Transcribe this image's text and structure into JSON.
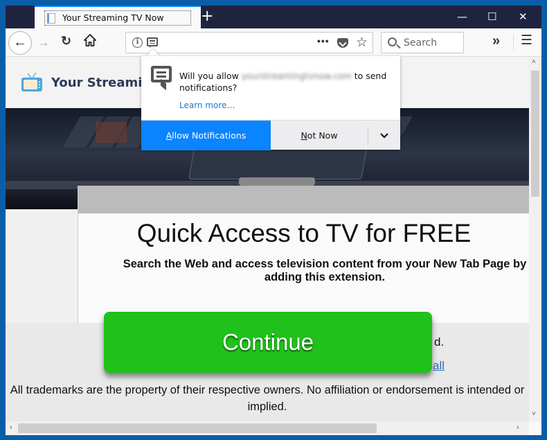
{
  "browser": {
    "tab": {
      "title": "Your Streaming TV Now",
      "close_glyph": "✕"
    },
    "new_tab_glyph": "+",
    "window_controls": {
      "minimize": "—",
      "maximize": "☐",
      "close": "✕"
    },
    "nav": {
      "back": "←",
      "forward": "→",
      "reload": "↻"
    },
    "urlbar": {
      "page_actions_glyph": "•••",
      "star_glyph": "☆"
    },
    "search": {
      "placeholder": "Search"
    },
    "overflow_glyph": "»",
    "menu_glyph": "☰"
  },
  "popup": {
    "message_before": "Will you allow ",
    "domain": "yourstreamingtvnow.com",
    "message_after": " to send notifications?",
    "learn_more": "Learn more…",
    "allow_first": "A",
    "allow_rest": "llow Notifications",
    "notnow_first": "N",
    "notnow_rest": "ot Now",
    "more_glyph": "⌄"
  },
  "page": {
    "brand": "Your Streaming",
    "headline": "Quick Access to TV for FREE",
    "subheadline": "Search the Web and access television content from your New Tab Page by adding this extension.",
    "partial_text": "d.",
    "partial_link": "all",
    "disclaimer": "All trademarks are the property of their respective owners. No affiliation or endorsement is intended or implied.",
    "continue_label": "Continue"
  },
  "scrollbars": {
    "up": "˄",
    "down": "˅",
    "left": "‹",
    "right": "›"
  },
  "colors": {
    "accent": "#0a84ff",
    "continue_green": "#1fc11a",
    "tabbar": "#202340",
    "desktop": "#0a5ea8"
  }
}
